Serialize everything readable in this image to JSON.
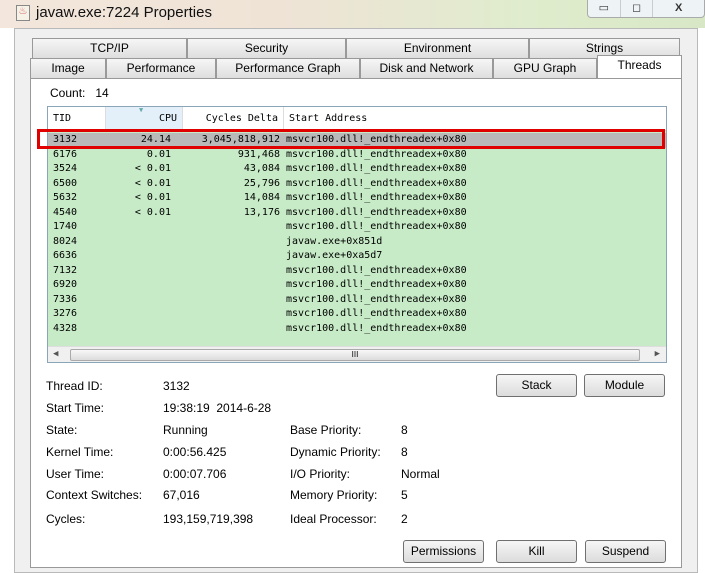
{
  "window": {
    "title": "javaw.exe:7224 Properties",
    "controls": [
      "▭",
      "◻",
      "X"
    ]
  },
  "tabs_row1": [
    "TCP/IP",
    "Security",
    "Environment",
    "Strings"
  ],
  "tabs_row2": [
    "Image",
    "Performance",
    "Performance Graph",
    "Disk and Network",
    "GPU Graph",
    "Threads"
  ],
  "active_tab": "Threads",
  "count": {
    "label": "Count:",
    "value": "14"
  },
  "table": {
    "columns": [
      "TID",
      "CPU",
      "Cycles Delta",
      "Start Address"
    ],
    "sorted_column": "CPU",
    "selected_tid": "3132",
    "rows": [
      [
        "3132",
        "24.14",
        "3,045,818,912",
        "msvcr100.dll!_endthreadex+0x80"
      ],
      [
        "6176",
        "0.01",
        "931,468",
        "msvcr100.dll!_endthreadex+0x80"
      ],
      [
        "3524",
        "< 0.01",
        "43,084",
        "msvcr100.dll!_endthreadex+0x80"
      ],
      [
        "6500",
        "< 0.01",
        "25,796",
        "msvcr100.dll!_endthreadex+0x80"
      ],
      [
        "5632",
        "< 0.01",
        "14,084",
        "msvcr100.dll!_endthreadex+0x80"
      ],
      [
        "4540",
        "< 0.01",
        "13,176",
        "msvcr100.dll!_endthreadex+0x80"
      ],
      [
        "1740",
        "",
        "",
        "msvcr100.dll!_endthreadex+0x80"
      ],
      [
        "8024",
        "",
        "",
        "javaw.exe+0x851d"
      ],
      [
        "6636",
        "",
        "",
        "javaw.exe+0xa5d7"
      ],
      [
        "7132",
        "",
        "",
        "msvcr100.dll!_endthreadex+0x80"
      ],
      [
        "6920",
        "",
        "",
        "msvcr100.dll!_endthreadex+0x80"
      ],
      [
        "7336",
        "",
        "",
        "msvcr100.dll!_endthreadex+0x80"
      ],
      [
        "3276",
        "",
        "",
        "msvcr100.dll!_endthreadex+0x80"
      ],
      [
        "4328",
        "",
        "",
        "msvcr100.dll!_endthreadex+0x80"
      ]
    ],
    "scroll_thumb": "III"
  },
  "details": {
    "thread_id": {
      "label": "Thread ID:",
      "value": "3132"
    },
    "start_time": {
      "label": "Start Time:",
      "value": "19:38:19  2014-6-28"
    },
    "state": {
      "label": "State:",
      "value": "Running"
    },
    "kernel_time": {
      "label": "Kernel Time:",
      "value": "0:00:56.425"
    },
    "user_time": {
      "label": "User Time:",
      "value": "0:00:07.706"
    },
    "context_switches": {
      "label": "Context Switches:",
      "value": "67,016"
    },
    "cycles": {
      "label": "Cycles:",
      "value": "193,159,719,398"
    },
    "base_priority": {
      "label": "Base Priority:",
      "value": "8"
    },
    "dynamic_priority": {
      "label": "Dynamic Priority:",
      "value": "8"
    },
    "io_priority": {
      "label": "I/O Priority:",
      "value": "Normal"
    },
    "memory_priority": {
      "label": "Memory Priority:",
      "value": "5"
    },
    "ideal_processor": {
      "label": "Ideal Processor:",
      "value": "2"
    }
  },
  "buttons": {
    "stack": "Stack",
    "module": "Module",
    "permissions": "Permissions",
    "kill": "Kill",
    "suspend": "Suspend"
  },
  "colors": {
    "table_bg": "#c7ebc7",
    "selected_row": "#b9b9b9",
    "highlight_box": "#e00000"
  }
}
